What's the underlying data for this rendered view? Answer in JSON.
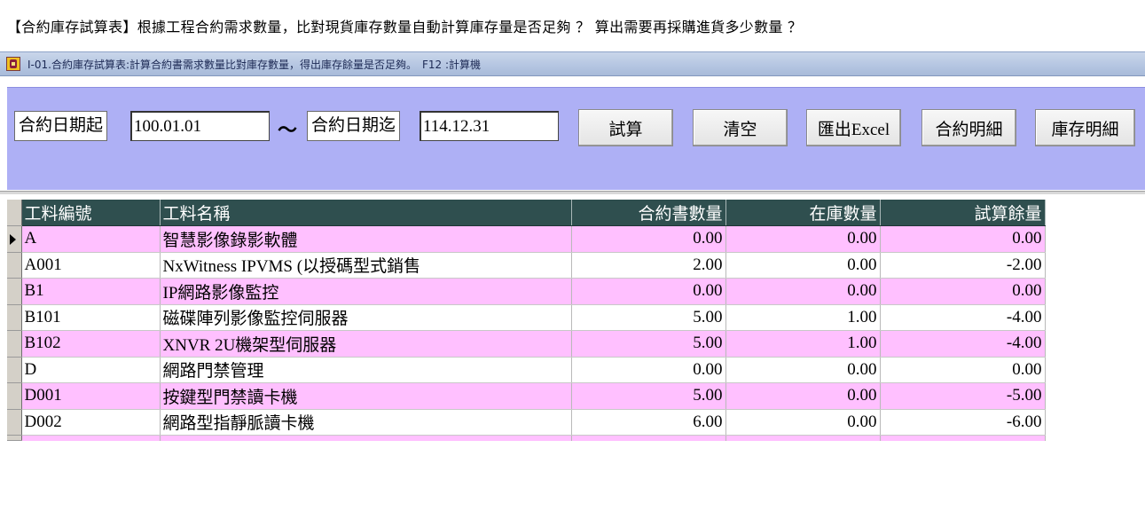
{
  "headline": "【合約庫存試算表】根據工程合約需求數量，比對現貨庫存數量自動計算庫存量是否足夠 ？ 算出需要再採購進貨多少數量 ？",
  "window": {
    "title": "I-01.合約庫存試算表:計算合約書需求數量比對庫存數量，得出庫存餘量是否足夠。　F12 :計算機"
  },
  "filters": {
    "start_label": "合約日期起",
    "start_value": "100.01.01",
    "separator": "～",
    "end_label": "合約日期迄",
    "end_value": "114.12.31"
  },
  "buttons": {
    "calculate": "試算",
    "clear": "清空",
    "export": "匯出Excel",
    "contract_detail": "合約明細",
    "stock_detail": "庫存明細"
  },
  "table": {
    "columns": [
      "工料編號",
      "工料名稱",
      "合約書數量",
      "在庫數量",
      "試算餘量"
    ],
    "rows": [
      {
        "code": "A",
        "name": "智慧影像錄影軟體",
        "contract_qty": "0.00",
        "stock_qty": "0.00",
        "balance": "0.00"
      },
      {
        "code": "A001",
        "name": "NxWitness IPVMS (以授碼型式銷售",
        "contract_qty": "2.00",
        "stock_qty": "0.00",
        "balance": "-2.00"
      },
      {
        "code": "B1",
        "name": "IP網路影像監控",
        "contract_qty": "0.00",
        "stock_qty": "0.00",
        "balance": "0.00"
      },
      {
        "code": "B101",
        "name": "磁碟陣列影像監控伺服器",
        "contract_qty": "5.00",
        "stock_qty": "1.00",
        "balance": "-4.00"
      },
      {
        "code": "B102",
        "name": "XNVR 2U機架型伺服器",
        "contract_qty": "5.00",
        "stock_qty": "1.00",
        "balance": "-4.00"
      },
      {
        "code": "D",
        "name": "網路門禁管理",
        "contract_qty": "0.00",
        "stock_qty": "0.00",
        "balance": "0.00"
      },
      {
        "code": "D001",
        "name": "按鍵型門禁讀卡機",
        "contract_qty": "5.00",
        "stock_qty": "0.00",
        "balance": "-5.00"
      },
      {
        "code": "D002",
        "name": "網路型指靜脈讀卡機",
        "contract_qty": "6.00",
        "stock_qty": "0.00",
        "balance": "-6.00"
      }
    ]
  },
  "colors": {
    "panel": "#aeb0f5",
    "header": "#2f4f4f",
    "row_alt": "#ffc0ff"
  }
}
